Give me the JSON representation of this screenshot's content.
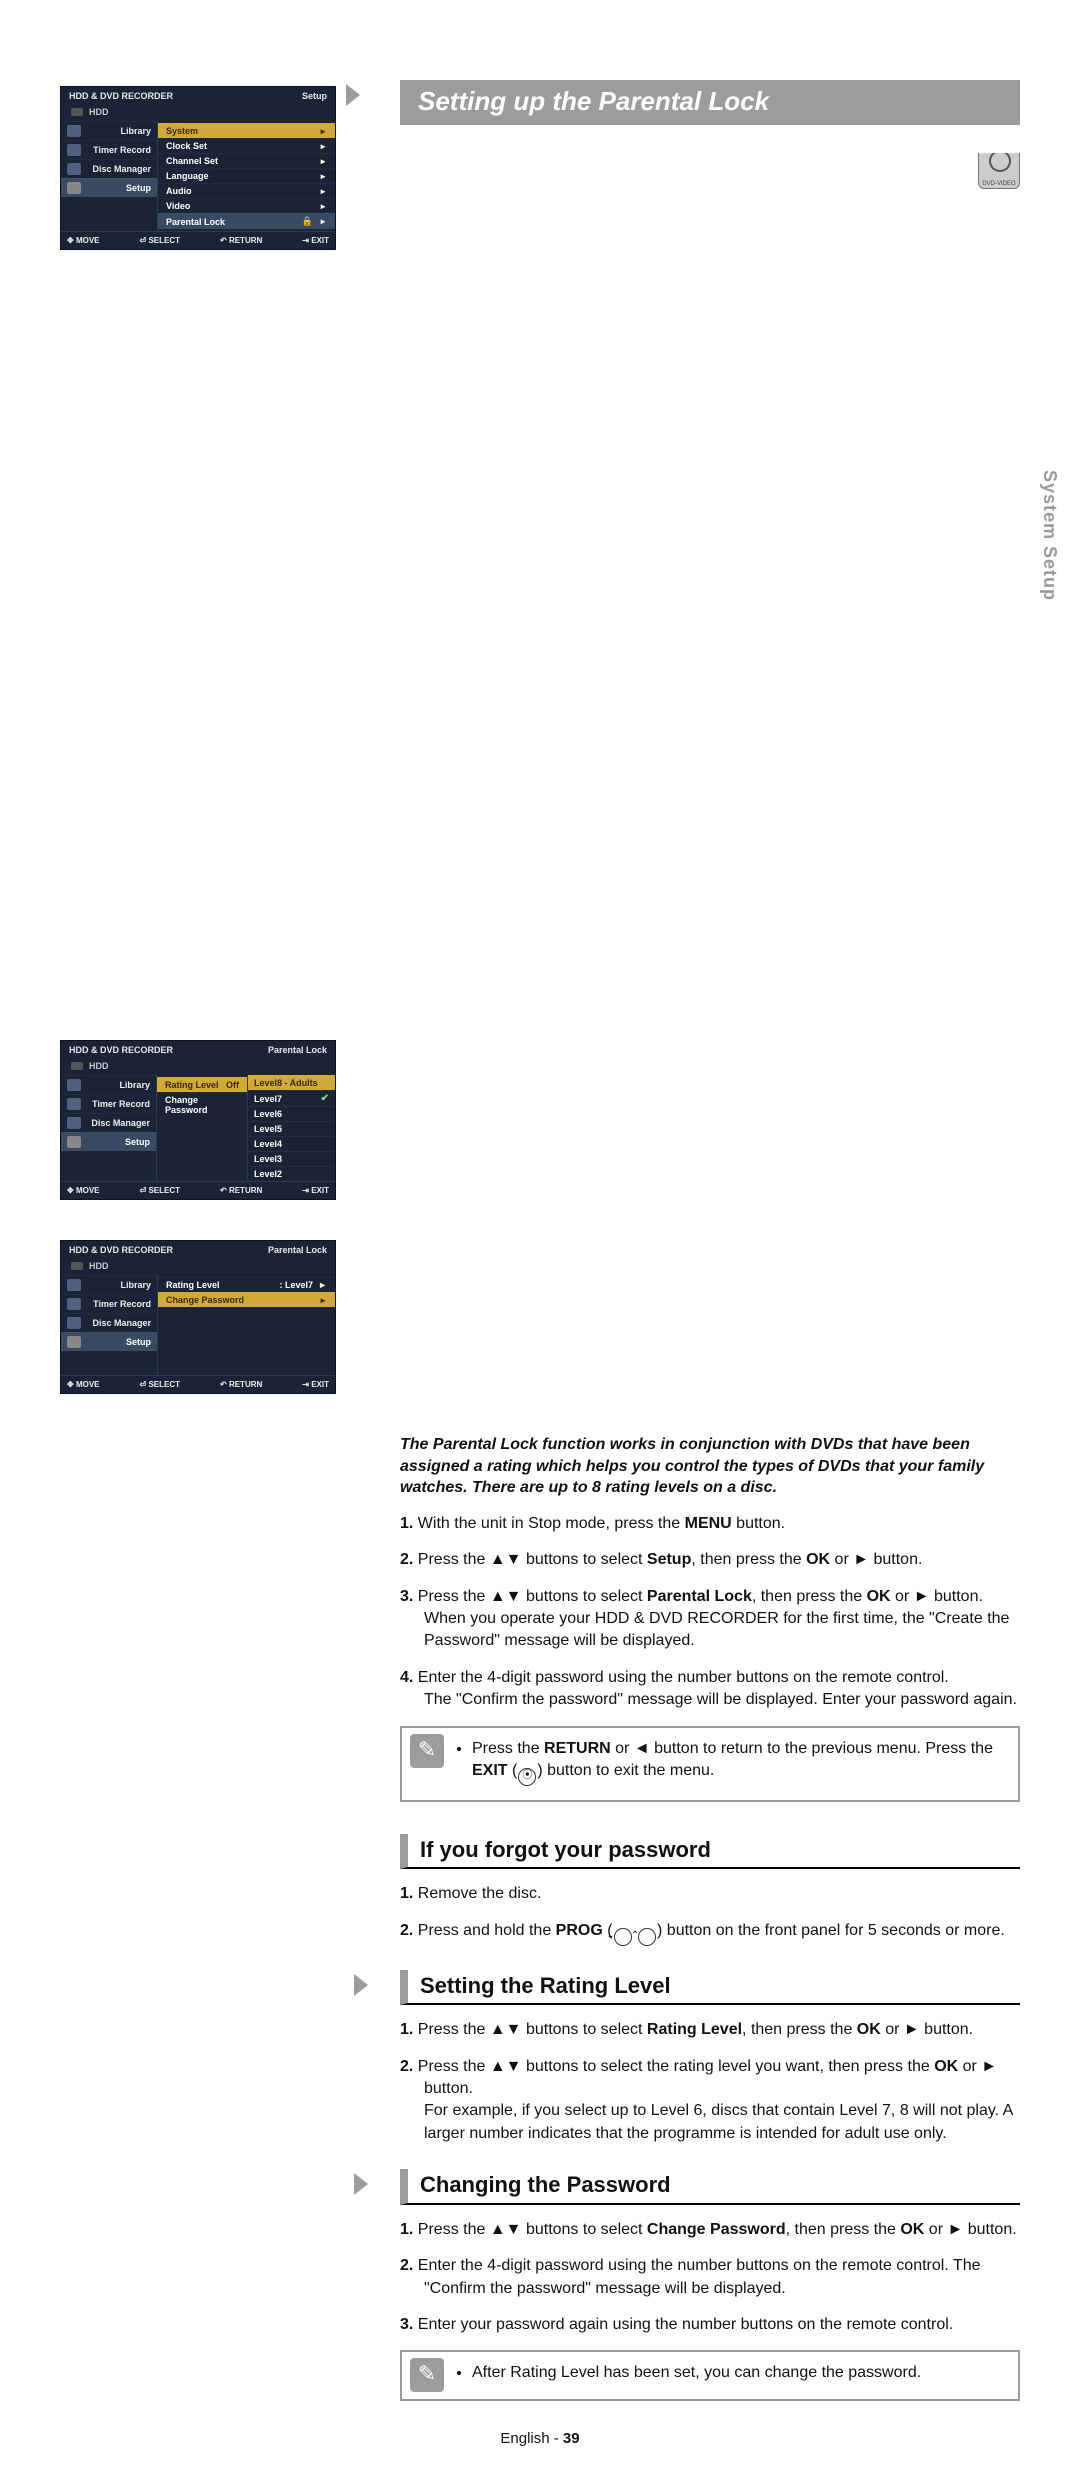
{
  "header": {
    "title": "Setting up the Parental Lock",
    "dvd_label": "DVD-VIDEO"
  },
  "intro": "The Parental Lock function works in conjunction with DVDs that have been assigned a rating which helps you control the types of DVDs that your family watches. There are up to 8 rating levels on a disc.",
  "steps_main": {
    "s1a": "With the unit in Stop mode, press the ",
    "s1b": "MENU",
    "s1c": " button.",
    "s2a": "Press the ▲▼ buttons to select ",
    "s2b": "Setup",
    "s2c": ", then press the ",
    "s2d": "OK",
    "s2e": " or ► button.",
    "s3a": "Press the ▲▼ buttons to select ",
    "s3b": "Parental Lock",
    "s3c": ", then press the ",
    "s3d": "OK",
    "s3e": " or ► button.",
    "s3f": "When you operate your HDD & DVD RECORDER for the first time, the \"Create the Password\" message will be displayed.",
    "s4a": "Enter the 4-digit password using the number buttons on the remote control.",
    "s4b": "The \"Confirm the password\" message will be displayed. Enter your password again."
  },
  "note1": {
    "l1a": "Press the ",
    "l1b": "RETURN",
    "l1c": " or ◄ button to return to the previous menu. Press the ",
    "l1d": "EXIT",
    "l1e_glyph": "⦿",
    "l1f": " button to exit the menu."
  },
  "sub_forgot": {
    "title": "If you forgot your password",
    "s1": "Remove the disc.",
    "s2a": "Press and hold the ",
    "s2b": "PROG",
    "s2c": " button on the front panel for 5 seconds or more.",
    "ring1": "⌄",
    "ring2": "⌃"
  },
  "sub_rating": {
    "title": "Setting the Rating Level",
    "s1a": "Press the ▲▼ buttons to select ",
    "s1b": "Rating Level",
    "s1c": ", then press the ",
    "s1d": "OK",
    "s1e": " or ► button.",
    "s2a": "Press the ▲▼ buttons to select the rating level you want, then press the ",
    "s2b": "OK",
    "s2c": " or ► button.",
    "s2d": "For example, if you select up to Level 6, discs that contain Level 7, 8 will not play. A larger number indicates that the programme is intended for adult use only."
  },
  "sub_changepw": {
    "title": "Changing the Password",
    "s1a": "Press the ▲▼ buttons to select ",
    "s1b": "Change Password",
    "s1c": ", then press the ",
    "s1d": "OK",
    "s1e": " or ► button.",
    "s2": "Enter the 4-digit password using the number buttons on the remote control. The \"Confirm the password\" message will be displayed.",
    "s3": "Enter your password again using the number buttons on the remote control."
  },
  "note2": "After Rating Level has been set, you can change the password.",
  "side_tab": "System Setup",
  "footer": {
    "lang": "English",
    "page": "39"
  },
  "osd": {
    "title": "HDD & DVD RECORDER",
    "hdd": "HDD",
    "sidebar": [
      "Library",
      "Timer Record",
      "Disc Manager",
      "Setup"
    ],
    "foot": {
      "move": "MOVE",
      "select": "SELECT",
      "return": "RETURN",
      "exit": "EXIT"
    }
  },
  "osd1": {
    "corner": "Setup",
    "menu": [
      {
        "label": "System"
      },
      {
        "label": "Clock Set"
      },
      {
        "label": "Channel Set"
      },
      {
        "label": "Language"
      },
      {
        "label": "Audio"
      },
      {
        "label": "Video"
      },
      {
        "label": "Parental Lock",
        "lock": true
      }
    ]
  },
  "osd2": {
    "corner": "Parental Lock",
    "menu": [
      {
        "label": "Rating Level",
        "value": "Off",
        "sel": true
      },
      {
        "label": "Change Password"
      }
    ],
    "levels": [
      "Level8 - Adults",
      "Level7",
      "Level6",
      "Level5",
      "Level4",
      "Level3",
      "Level2"
    ],
    "level_sel": 0,
    "level_check": 1
  },
  "osd3": {
    "corner": "Parental Lock",
    "menu": [
      {
        "label": "Rating Level",
        "value": ": Level7"
      },
      {
        "label": "Change Password",
        "sel": true
      }
    ]
  }
}
